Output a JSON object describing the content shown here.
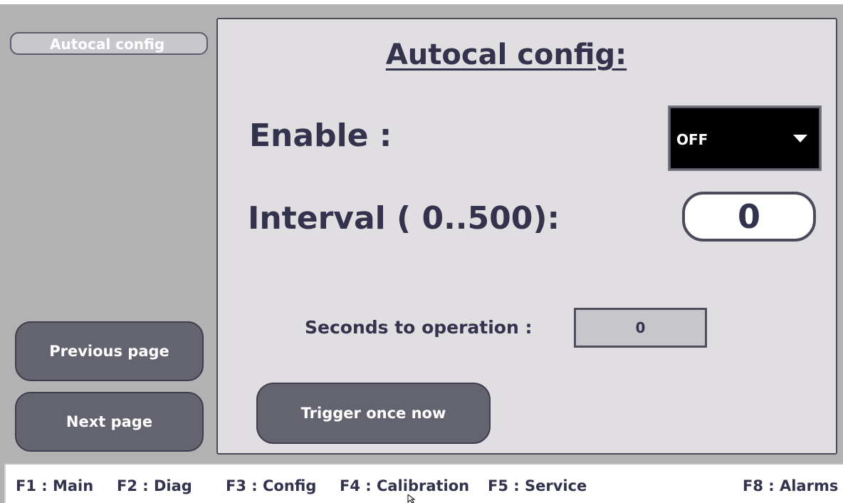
{
  "sidebar": {
    "title": "Autocal config",
    "previous_label": "Previous page",
    "next_label": "Next page"
  },
  "main": {
    "title": "Autocal config:",
    "enable_label": "Enable :",
    "enable_value": "OFF",
    "interval_label": "Interval ( 0..500):",
    "interval_value": "0",
    "seconds_label": "Seconds to operation :",
    "seconds_value": "0",
    "trigger_label": "Trigger once now"
  },
  "footer": {
    "keys": [
      {
        "label": "F1 : Main"
      },
      {
        "label": "F2 : Diag"
      },
      {
        "label": "F3 : Config"
      },
      {
        "label": "F4 : Calibration"
      },
      {
        "label": "F5 : Service"
      },
      {
        "label": "F8 : Alarms"
      }
    ]
  },
  "colors": {
    "background": "#b2b2b2",
    "panel": "#e0dee1",
    "text": "#33334d",
    "button": "#63646f",
    "dropdown": "#000000"
  },
  "icons": {
    "dropdown_caret": "chevron-down-icon",
    "mouse_cursor": "cursor-icon"
  }
}
